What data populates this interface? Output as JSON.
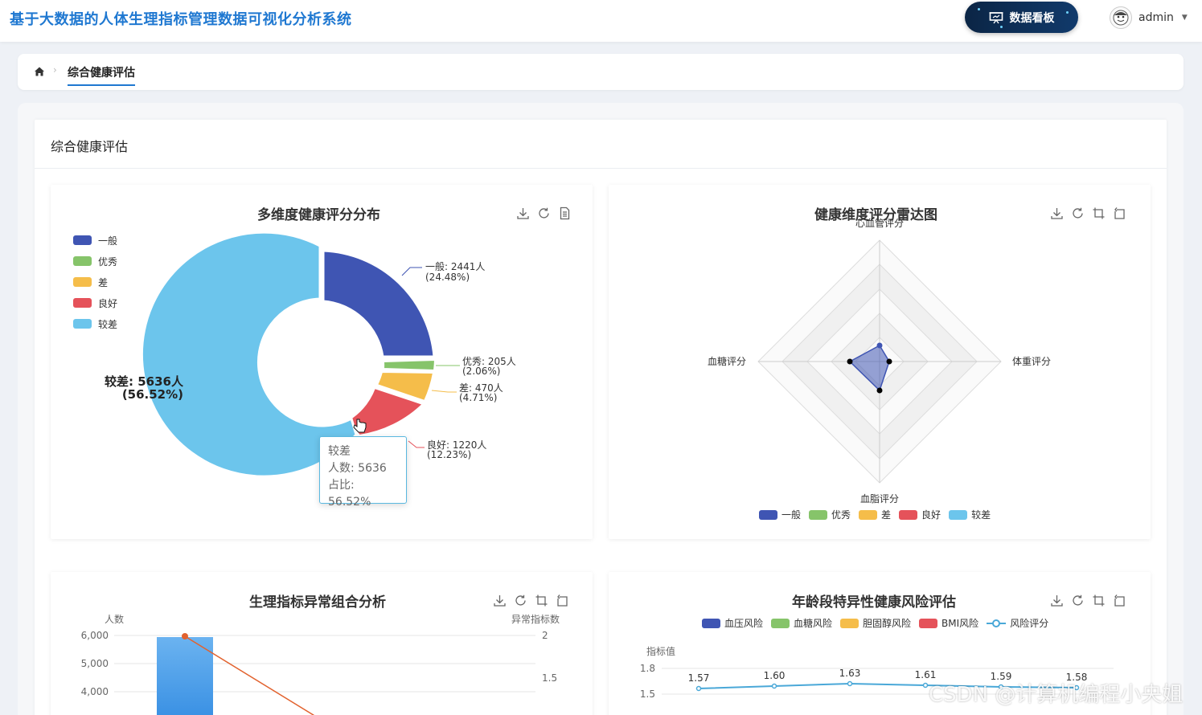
{
  "header": {
    "title": "基于大数据的人体生理指标管理数据可视化分析系统",
    "dashboard_button": "数据看板",
    "username": "admin"
  },
  "breadcrumb": {
    "current": "综合健康评估"
  },
  "card": {
    "title": "综合健康评估"
  },
  "colors": {
    "blue": "#3f55b3",
    "green": "#86c46a",
    "yellow": "#f5bd4a",
    "red": "#e5525a",
    "lightblue": "#6cc5ec",
    "accent": "#1f78d1"
  },
  "pie_panel": {
    "title": "多维度健康评分分布",
    "legend": [
      "一般",
      "优秀",
      "差",
      "良好",
      "较差"
    ],
    "labels": {
      "general": [
        "一般: 2441人",
        "(24.48%)"
      ],
      "excellent": [
        "优秀: 205人",
        "(2.06%)"
      ],
      "poor": [
        "差: 470人",
        "(4.71%)"
      ],
      "good": [
        "良好: 1220人",
        "(12.23%)"
      ],
      "weak": [
        "较差: 5636人",
        "(56.52%)"
      ]
    },
    "tooltip": {
      "name": "较差",
      "count": "人数: 5636",
      "ratio": "占比: 56.52%"
    }
  },
  "radar_panel": {
    "title": "健康维度评分雷达图",
    "axes": {
      "top": "心血管评分",
      "right": "体重评分",
      "bottom": "血脂评分",
      "left": "血糖评分"
    },
    "legend": [
      "一般",
      "优秀",
      "差",
      "良好",
      "较差"
    ]
  },
  "combo_panel": {
    "title": "生理指标异常组合分析",
    "y_left_label": "人数",
    "y_right_label": "异常指标数",
    "y_left_ticks": [
      "6,000",
      "5,000",
      "4,000"
    ],
    "y_right_ticks": [
      "2",
      "1.5"
    ]
  },
  "age_panel": {
    "title": "年龄段特异性健康风险评估",
    "legend": [
      "血压风险",
      "血糖风险",
      "胆固醇风险",
      "BMI风险",
      "风险评分"
    ],
    "y_label": "指标值",
    "y_ticks": [
      "1.8",
      "1.5"
    ],
    "point_labels": [
      "1.57",
      "1.60",
      "1.63",
      "1.61",
      "1.59",
      "1.58"
    ]
  },
  "watermark": "CSDN @计算机编程小央姐",
  "chart_data": [
    {
      "type": "pie",
      "title": "多维度健康评分分布",
      "categories": [
        "一般",
        "优秀",
        "差",
        "良好",
        "较差"
      ],
      "values": [
        2441,
        205,
        470,
        1220,
        5636
      ],
      "percent": [
        24.48,
        2.06,
        4.71,
        12.23,
        56.52
      ]
    },
    {
      "type": "radar",
      "title": "健康维度评分雷达图",
      "axes": [
        "心血管评分",
        "体重评分",
        "血脂评分",
        "血糖评分"
      ],
      "series": [
        "一般",
        "优秀",
        "差",
        "良好",
        "较差"
      ]
    },
    {
      "type": "bar",
      "title": "生理指标异常组合分析",
      "ylabel": "人数",
      "y2label": "异常指标数",
      "values": [
        6000
      ],
      "line_values": [
        2
      ]
    },
    {
      "type": "line",
      "title": "年龄段特异性健康风险评估",
      "ylabel": "指标值",
      "series": [
        {
          "name": "风险评分",
          "values": [
            1.57,
            1.6,
            1.63,
            1.61,
            1.59,
            1.58
          ]
        }
      ]
    }
  ]
}
